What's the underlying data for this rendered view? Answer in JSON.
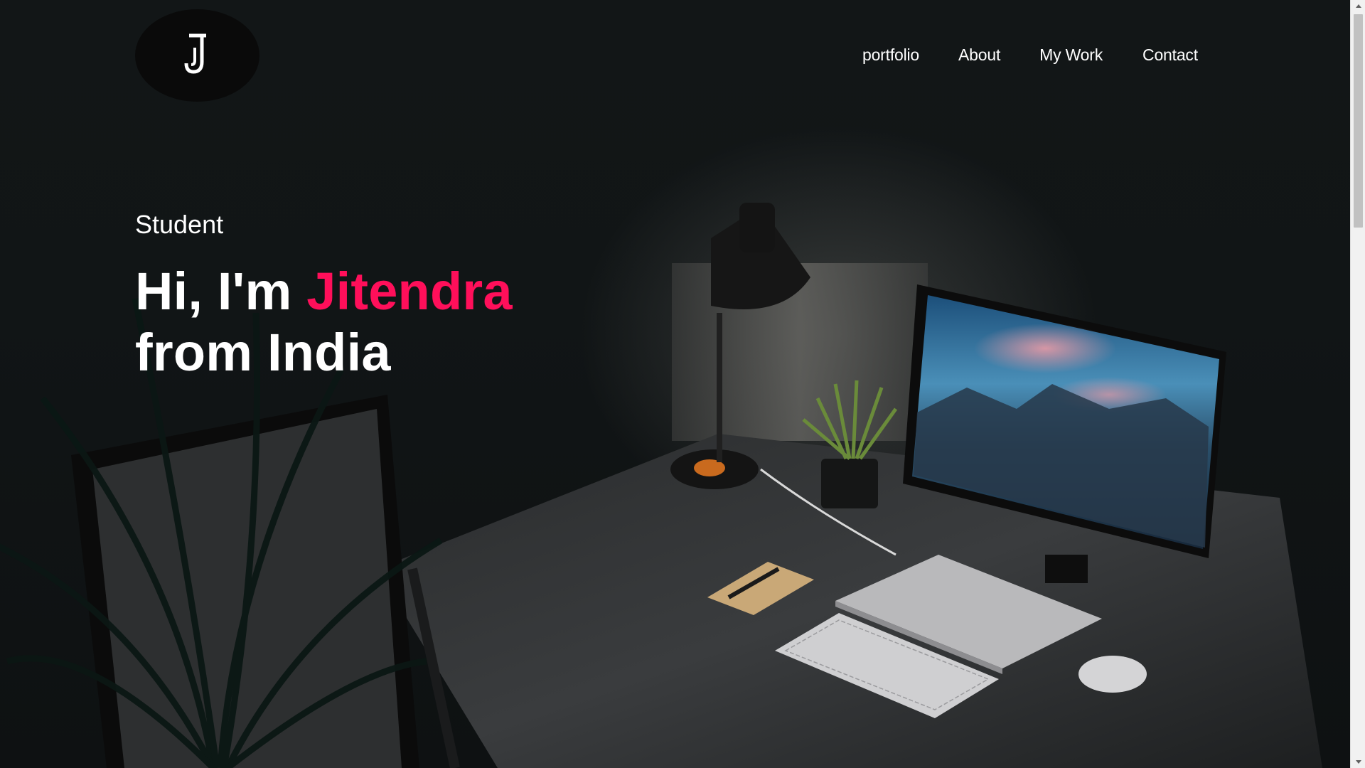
{
  "header": {
    "logo_glyph": "J",
    "nav": [
      {
        "label": "portfolio"
      },
      {
        "label": "About"
      },
      {
        "label": "My Work"
      },
      {
        "label": "Contact"
      }
    ]
  },
  "hero": {
    "subtitle": "Student",
    "greeting": "Hi, I'm ",
    "name": "Jitendra",
    "line2": "from India"
  },
  "colors": {
    "accent": "#ff0f5a",
    "text": "#ffffff",
    "logo_bg": "#0a0a0a"
  },
  "background": {
    "icons": [
      "desk-lamp-icon",
      "monitor-icon",
      "plant-icon",
      "laptop-icon",
      "keyboard-icon",
      "mouse-icon",
      "notebook-icon"
    ]
  }
}
